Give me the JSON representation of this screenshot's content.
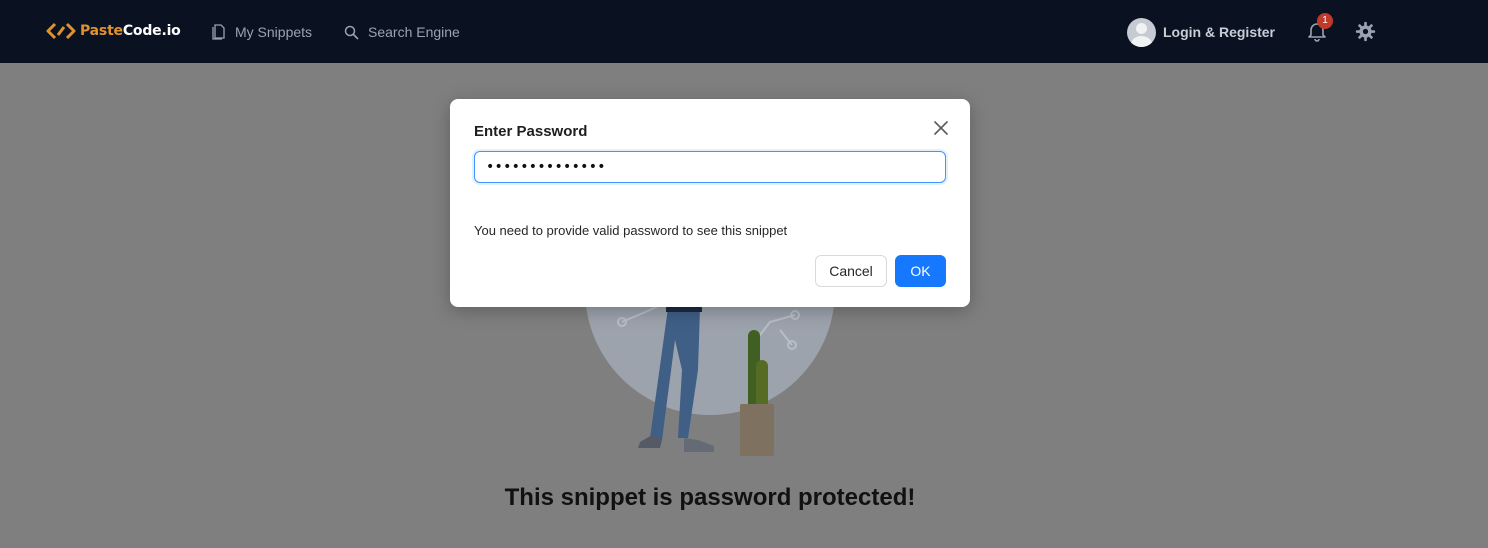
{
  "navbar": {
    "logo": {
      "part1": "Paste",
      "part2": "Code.io"
    },
    "links": [
      {
        "label": "My Snippets",
        "icon": "file-icon"
      },
      {
        "label": "Search Engine",
        "icon": "search-icon"
      }
    ],
    "login_label": "Login & Register",
    "notification_count": "1",
    "colors": {
      "background": "#0a1222",
      "logo_accent": "#e0922f",
      "badge": "#c0392b"
    }
  },
  "page": {
    "title": "This snippet is password protected!"
  },
  "modal": {
    "title": "Enter Password",
    "password_value": "••••••••••••••",
    "message": "You need to provide valid password to see this snippet",
    "cancel_label": "Cancel",
    "ok_label": "OK",
    "colors": {
      "primary": "#1677ff"
    }
  }
}
